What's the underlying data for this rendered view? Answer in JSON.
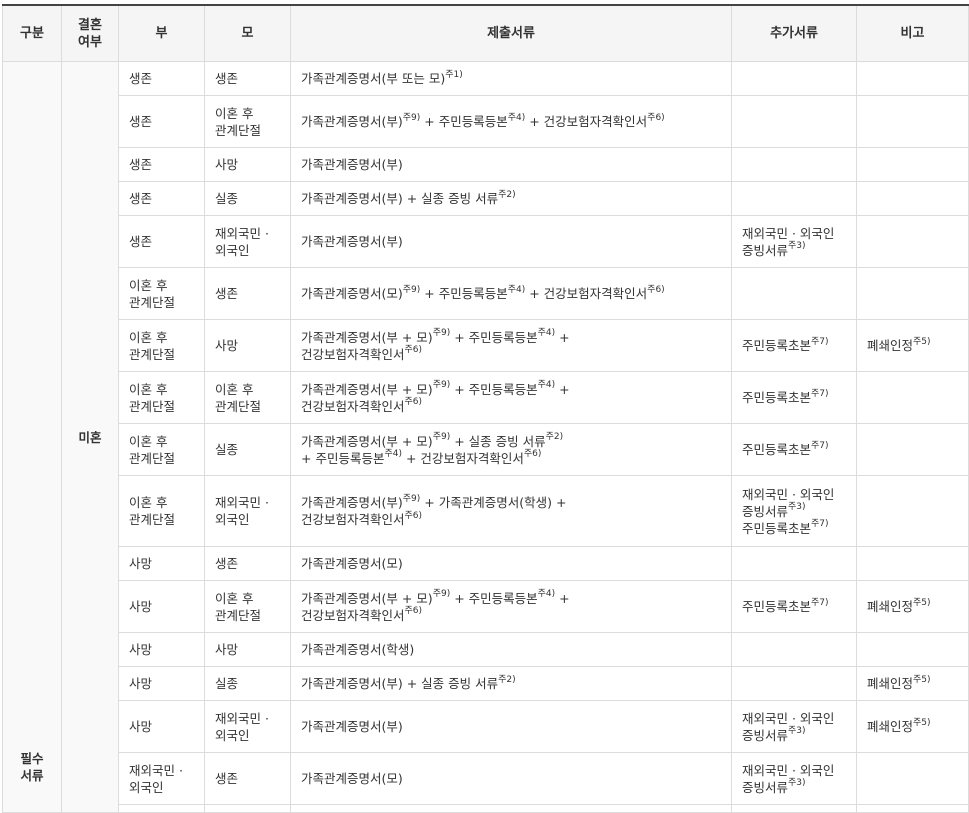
{
  "headers": [
    "구분",
    "결혼\n여부",
    "부",
    "모",
    "제출서류",
    "추가서류",
    "비고"
  ],
  "category": "필수\n서류",
  "marital": "미혼",
  "rows": [
    {
      "father": "생존",
      "mother": "생존",
      "docs": "가족관계증명서(부 또는 모)^주1)",
      "extra": "",
      "note": ""
    },
    {
      "father": "생존",
      "mother": "이혼 후\n관계단절",
      "docs": "가족관계증명서(부)^주9) + 주민등록등본^주4) + 건강보험자격확인서^주6)",
      "extra": "",
      "note": ""
    },
    {
      "father": "생존",
      "mother": "사망",
      "docs": "가족관계증명서(부)",
      "extra": "",
      "note": ""
    },
    {
      "father": "생존",
      "mother": "실종",
      "docs": "가족관계증명서(부) + 실종 증빙 서류^주2)",
      "extra": "",
      "note": ""
    },
    {
      "father": "생존",
      "mother": "재외국민 ·\n외국인",
      "docs": "가족관계증명서(부)",
      "extra": "재외국민 · 외국인\n증빙서류^주3)",
      "note": ""
    },
    {
      "father": "이혼 후\n관계단절",
      "mother": "생존",
      "docs": "가족관계증명서(모)^주9) + 주민등록등본^주4) + 건강보험자격확인서^주6)",
      "extra": "",
      "note": ""
    },
    {
      "father": "이혼 후\n관계단절",
      "mother": "사망",
      "docs": "가족관계증명서(부 + 모)^주9) + 주민등록등본^주4) +\n건강보험자격확인서^주6)",
      "extra": "주민등록초본^주7)",
      "note": "폐쇄인정^주5)"
    },
    {
      "father": "이혼 후\n관계단절",
      "mother": "이혼 후\n관계단절",
      "docs": "가족관계증명서(부 + 모)^주9) + 주민등록등본^주4) +\n건강보험자격확인서^주6)",
      "extra": "주민등록초본^주7)",
      "note": ""
    },
    {
      "father": "이혼 후\n관계단절",
      "mother": "실종",
      "docs": "가족관계증명서(부 + 모)^주9) + 실종 증빙 서류^주2)\n+ 주민등록등본^주4) + 건강보험자격확인서^주6)",
      "extra": "주민등록초본^주7)",
      "note": ""
    },
    {
      "father": "이혼 후\n관계단절",
      "mother": "재외국민 ·\n외국인",
      "docs": "가족관계증명서(부)^주9) + 가족관계증명서(학생) +\n건강보험자격확인서^주6)",
      "extra": "재외국민 · 외국인\n증빙서류^주3)\n주민등록초본^주7)",
      "note": ""
    },
    {
      "father": "사망",
      "mother": "생존",
      "docs": "가족관계증명서(모)",
      "extra": "",
      "note": ""
    },
    {
      "father": "사망",
      "mother": "이혼 후\n관계단절",
      "docs": "가족관계증명서(부 + 모)^주9) + 주민등록등본^주4) +\n건강보험자격확인서^주6)",
      "extra": "주민등록초본^주7)",
      "note": "폐쇄인정^주5)"
    },
    {
      "father": "사망",
      "mother": "사망",
      "docs": "가족관계증명서(학생)",
      "extra": "",
      "note": ""
    },
    {
      "father": "사망",
      "mother": "실종",
      "docs": "가족관계증명서(부) + 실종 증빙 서류^주2)",
      "extra": "",
      "note": "폐쇄인정^주5)"
    },
    {
      "father": "사망",
      "mother": "재외국민 ·\n외국인",
      "docs": "가족관계증명서(부)",
      "extra": "재외국민 · 외국인\n증빙서류^주3)",
      "note": "폐쇄인정^주5)"
    },
    {
      "father": "재외국민 ·\n외국인",
      "mother": "생존",
      "docs": "가족관계증명서(모)",
      "extra": "재외국민 · 외국인\n증빙서류^주3)",
      "note": ""
    },
    {
      "father": "",
      "mother": "",
      "docs": "",
      "extra": "",
      "note": ""
    }
  ]
}
